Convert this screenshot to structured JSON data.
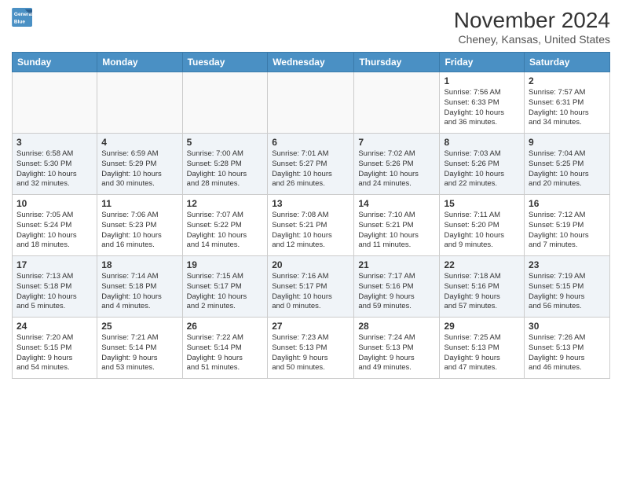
{
  "header": {
    "logo_line1": "General",
    "logo_line2": "Blue",
    "month": "November 2024",
    "location": "Cheney, Kansas, United States"
  },
  "days_of_week": [
    "Sunday",
    "Monday",
    "Tuesday",
    "Wednesday",
    "Thursday",
    "Friday",
    "Saturday"
  ],
  "weeks": [
    [
      {
        "num": "",
        "info": ""
      },
      {
        "num": "",
        "info": ""
      },
      {
        "num": "",
        "info": ""
      },
      {
        "num": "",
        "info": ""
      },
      {
        "num": "",
        "info": ""
      },
      {
        "num": "1",
        "info": "Sunrise: 7:56 AM\nSunset: 6:33 PM\nDaylight: 10 hours\nand 36 minutes."
      },
      {
        "num": "2",
        "info": "Sunrise: 7:57 AM\nSunset: 6:31 PM\nDaylight: 10 hours\nand 34 minutes."
      }
    ],
    [
      {
        "num": "3",
        "info": "Sunrise: 6:58 AM\nSunset: 5:30 PM\nDaylight: 10 hours\nand 32 minutes."
      },
      {
        "num": "4",
        "info": "Sunrise: 6:59 AM\nSunset: 5:29 PM\nDaylight: 10 hours\nand 30 minutes."
      },
      {
        "num": "5",
        "info": "Sunrise: 7:00 AM\nSunset: 5:28 PM\nDaylight: 10 hours\nand 28 minutes."
      },
      {
        "num": "6",
        "info": "Sunrise: 7:01 AM\nSunset: 5:27 PM\nDaylight: 10 hours\nand 26 minutes."
      },
      {
        "num": "7",
        "info": "Sunrise: 7:02 AM\nSunset: 5:26 PM\nDaylight: 10 hours\nand 24 minutes."
      },
      {
        "num": "8",
        "info": "Sunrise: 7:03 AM\nSunset: 5:26 PM\nDaylight: 10 hours\nand 22 minutes."
      },
      {
        "num": "9",
        "info": "Sunrise: 7:04 AM\nSunset: 5:25 PM\nDaylight: 10 hours\nand 20 minutes."
      }
    ],
    [
      {
        "num": "10",
        "info": "Sunrise: 7:05 AM\nSunset: 5:24 PM\nDaylight: 10 hours\nand 18 minutes."
      },
      {
        "num": "11",
        "info": "Sunrise: 7:06 AM\nSunset: 5:23 PM\nDaylight: 10 hours\nand 16 minutes."
      },
      {
        "num": "12",
        "info": "Sunrise: 7:07 AM\nSunset: 5:22 PM\nDaylight: 10 hours\nand 14 minutes."
      },
      {
        "num": "13",
        "info": "Sunrise: 7:08 AM\nSunset: 5:21 PM\nDaylight: 10 hours\nand 12 minutes."
      },
      {
        "num": "14",
        "info": "Sunrise: 7:10 AM\nSunset: 5:21 PM\nDaylight: 10 hours\nand 11 minutes."
      },
      {
        "num": "15",
        "info": "Sunrise: 7:11 AM\nSunset: 5:20 PM\nDaylight: 10 hours\nand 9 minutes."
      },
      {
        "num": "16",
        "info": "Sunrise: 7:12 AM\nSunset: 5:19 PM\nDaylight: 10 hours\nand 7 minutes."
      }
    ],
    [
      {
        "num": "17",
        "info": "Sunrise: 7:13 AM\nSunset: 5:18 PM\nDaylight: 10 hours\nand 5 minutes."
      },
      {
        "num": "18",
        "info": "Sunrise: 7:14 AM\nSunset: 5:18 PM\nDaylight: 10 hours\nand 4 minutes."
      },
      {
        "num": "19",
        "info": "Sunrise: 7:15 AM\nSunset: 5:17 PM\nDaylight: 10 hours\nand 2 minutes."
      },
      {
        "num": "20",
        "info": "Sunrise: 7:16 AM\nSunset: 5:17 PM\nDaylight: 10 hours\nand 0 minutes."
      },
      {
        "num": "21",
        "info": "Sunrise: 7:17 AM\nSunset: 5:16 PM\nDaylight: 9 hours\nand 59 minutes."
      },
      {
        "num": "22",
        "info": "Sunrise: 7:18 AM\nSunset: 5:16 PM\nDaylight: 9 hours\nand 57 minutes."
      },
      {
        "num": "23",
        "info": "Sunrise: 7:19 AM\nSunset: 5:15 PM\nDaylight: 9 hours\nand 56 minutes."
      }
    ],
    [
      {
        "num": "24",
        "info": "Sunrise: 7:20 AM\nSunset: 5:15 PM\nDaylight: 9 hours\nand 54 minutes."
      },
      {
        "num": "25",
        "info": "Sunrise: 7:21 AM\nSunset: 5:14 PM\nDaylight: 9 hours\nand 53 minutes."
      },
      {
        "num": "26",
        "info": "Sunrise: 7:22 AM\nSunset: 5:14 PM\nDaylight: 9 hours\nand 51 minutes."
      },
      {
        "num": "27",
        "info": "Sunrise: 7:23 AM\nSunset: 5:13 PM\nDaylight: 9 hours\nand 50 minutes."
      },
      {
        "num": "28",
        "info": "Sunrise: 7:24 AM\nSunset: 5:13 PM\nDaylight: 9 hours\nand 49 minutes."
      },
      {
        "num": "29",
        "info": "Sunrise: 7:25 AM\nSunset: 5:13 PM\nDaylight: 9 hours\nand 47 minutes."
      },
      {
        "num": "30",
        "info": "Sunrise: 7:26 AM\nSunset: 5:13 PM\nDaylight: 9 hours\nand 46 minutes."
      }
    ]
  ]
}
